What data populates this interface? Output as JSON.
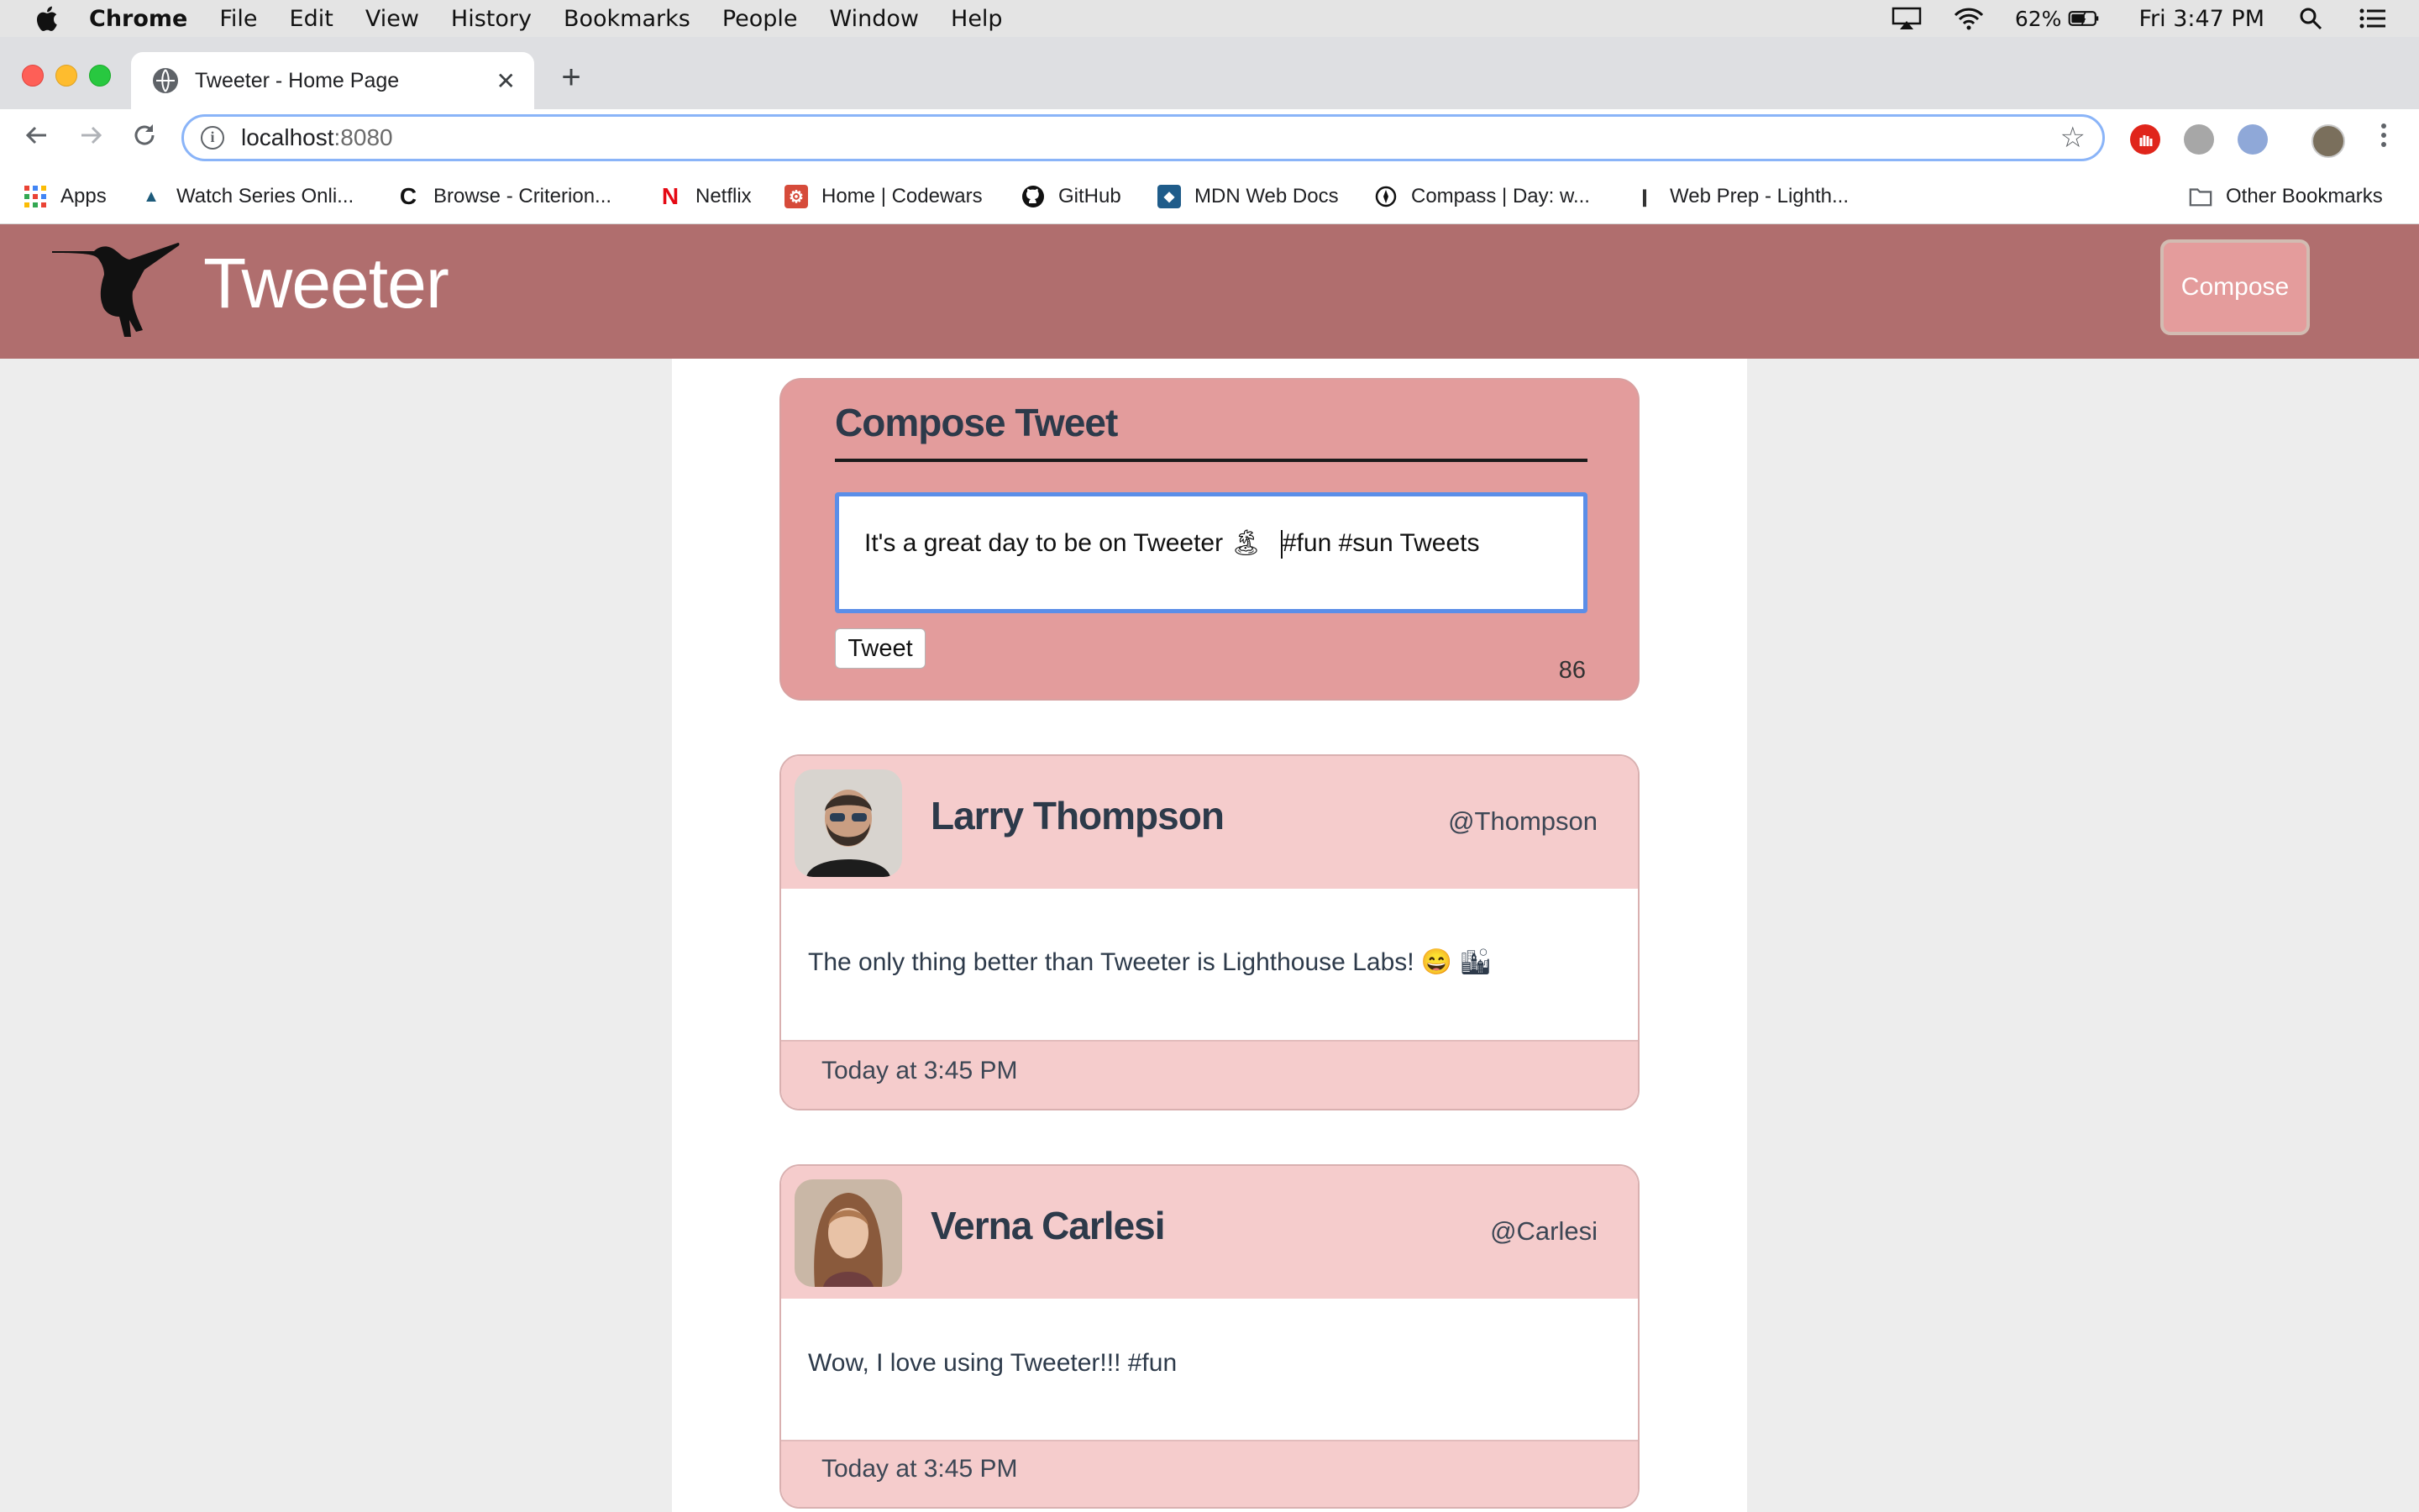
{
  "menubar": {
    "app_name": "Chrome",
    "items": [
      "File",
      "Edit",
      "View",
      "History",
      "Bookmarks",
      "People",
      "Window",
      "Help"
    ],
    "battery": "62%",
    "clock": "Fri 3:47 PM"
  },
  "browser": {
    "tab_title": "Tweeter - Home Page",
    "url_host": "localhost",
    "url_port": ":8080",
    "bookmarks": [
      "Apps",
      "Watch Series Onli...",
      "Browse - Criterion...",
      "Netflix",
      "Home | Codewars",
      "GitHub",
      "MDN Web Docs",
      "Compass | Day: w...",
      "Web Prep - Lighth...",
      "Other Bookmarks"
    ]
  },
  "nav": {
    "brand": "Tweeter",
    "compose_label": "Compose"
  },
  "compose": {
    "title": "Compose Tweet",
    "text_before": "It's a great day to be on Tweeter 🏝",
    "text_after": "#fun #sun Tweets",
    "button_label": "Tweet",
    "counter": "86"
  },
  "tweets": [
    {
      "name": "Larry Thompson",
      "handle": "@Thompson",
      "content": "The only thing better than Tweeter is Lighthouse Labs! 😄 🏙",
      "time": "Today at 3:45 PM"
    },
    {
      "name": "Verna Carlesi",
      "handle": "@Carlesi",
      "content": "Wow, I love using Tweeter!!! #fun",
      "time": "Today at 3:45 PM"
    }
  ],
  "colors": {
    "nav_bg": "#b06e6e",
    "compose_bg": "#e39c9c",
    "tweet_header_bg": "#f5cccc",
    "page_bg": "#ededed"
  }
}
